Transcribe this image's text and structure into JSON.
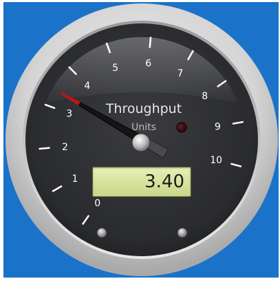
{
  "gauge": {
    "title": "Throughput",
    "units": "Units",
    "value": 3.4,
    "readout": "3.40",
    "min": 0,
    "max": 10,
    "scale_labels": [
      "0",
      "1",
      "2",
      "3",
      "4",
      "5",
      "6",
      "7",
      "8",
      "9",
      "10"
    ],
    "indicator_lamp": "off",
    "colors": {
      "background": "#1a73c9",
      "needle_tip": "#c0141a",
      "dial_face": "#2c2d30",
      "readout_lcd": "#d6e39c"
    }
  }
}
